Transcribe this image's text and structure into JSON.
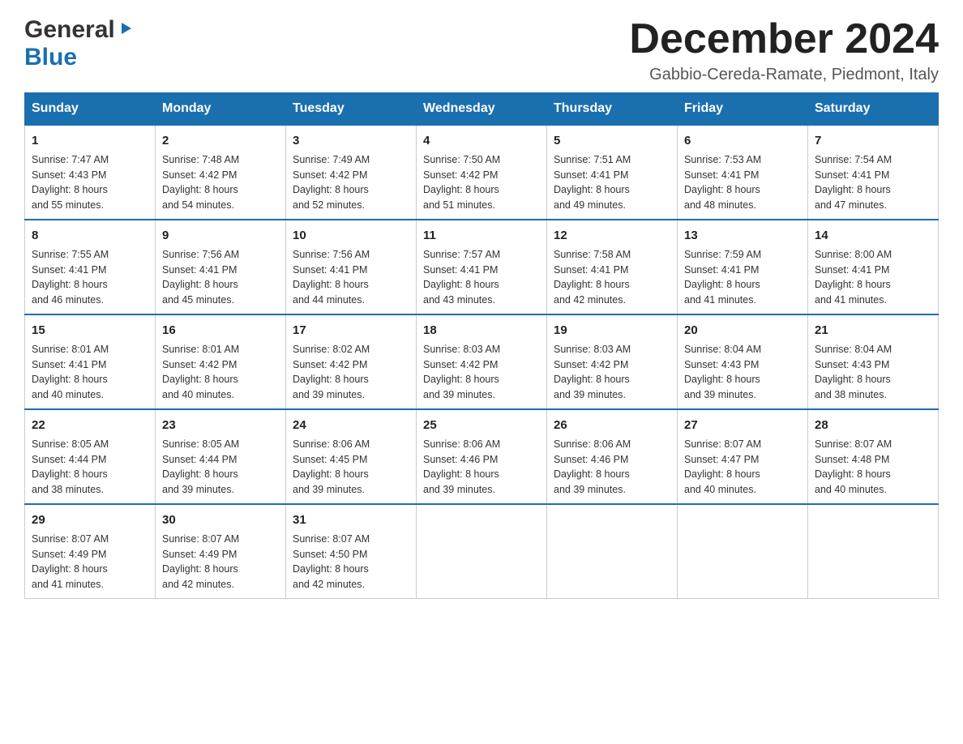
{
  "header": {
    "logo_general": "General",
    "logo_blue": "Blue",
    "month_title": "December 2024",
    "location": "Gabbio-Cereda-Ramate, Piedmont, Italy"
  },
  "days_of_week": [
    "Sunday",
    "Monday",
    "Tuesday",
    "Wednesday",
    "Thursday",
    "Friday",
    "Saturday"
  ],
  "weeks": [
    [
      {
        "day": "1",
        "sunrise": "7:47 AM",
        "sunset": "4:43 PM",
        "daylight": "8 hours and 55 minutes."
      },
      {
        "day": "2",
        "sunrise": "7:48 AM",
        "sunset": "4:42 PM",
        "daylight": "8 hours and 54 minutes."
      },
      {
        "day": "3",
        "sunrise": "7:49 AM",
        "sunset": "4:42 PM",
        "daylight": "8 hours and 52 minutes."
      },
      {
        "day": "4",
        "sunrise": "7:50 AM",
        "sunset": "4:42 PM",
        "daylight": "8 hours and 51 minutes."
      },
      {
        "day": "5",
        "sunrise": "7:51 AM",
        "sunset": "4:41 PM",
        "daylight": "8 hours and 49 minutes."
      },
      {
        "day": "6",
        "sunrise": "7:53 AM",
        "sunset": "4:41 PM",
        "daylight": "8 hours and 48 minutes."
      },
      {
        "day": "7",
        "sunrise": "7:54 AM",
        "sunset": "4:41 PM",
        "daylight": "8 hours and 47 minutes."
      }
    ],
    [
      {
        "day": "8",
        "sunrise": "7:55 AM",
        "sunset": "4:41 PM",
        "daylight": "8 hours and 46 minutes."
      },
      {
        "day": "9",
        "sunrise": "7:56 AM",
        "sunset": "4:41 PM",
        "daylight": "8 hours and 45 minutes."
      },
      {
        "day": "10",
        "sunrise": "7:56 AM",
        "sunset": "4:41 PM",
        "daylight": "8 hours and 44 minutes."
      },
      {
        "day": "11",
        "sunrise": "7:57 AM",
        "sunset": "4:41 PM",
        "daylight": "8 hours and 43 minutes."
      },
      {
        "day": "12",
        "sunrise": "7:58 AM",
        "sunset": "4:41 PM",
        "daylight": "8 hours and 42 minutes."
      },
      {
        "day": "13",
        "sunrise": "7:59 AM",
        "sunset": "4:41 PM",
        "daylight": "8 hours and 41 minutes."
      },
      {
        "day": "14",
        "sunrise": "8:00 AM",
        "sunset": "4:41 PM",
        "daylight": "8 hours and 41 minutes."
      }
    ],
    [
      {
        "day": "15",
        "sunrise": "8:01 AM",
        "sunset": "4:41 PM",
        "daylight": "8 hours and 40 minutes."
      },
      {
        "day": "16",
        "sunrise": "8:01 AM",
        "sunset": "4:42 PM",
        "daylight": "8 hours and 40 minutes."
      },
      {
        "day": "17",
        "sunrise": "8:02 AM",
        "sunset": "4:42 PM",
        "daylight": "8 hours and 39 minutes."
      },
      {
        "day": "18",
        "sunrise": "8:03 AM",
        "sunset": "4:42 PM",
        "daylight": "8 hours and 39 minutes."
      },
      {
        "day": "19",
        "sunrise": "8:03 AM",
        "sunset": "4:42 PM",
        "daylight": "8 hours and 39 minutes."
      },
      {
        "day": "20",
        "sunrise": "8:04 AM",
        "sunset": "4:43 PM",
        "daylight": "8 hours and 39 minutes."
      },
      {
        "day": "21",
        "sunrise": "8:04 AM",
        "sunset": "4:43 PM",
        "daylight": "8 hours and 38 minutes."
      }
    ],
    [
      {
        "day": "22",
        "sunrise": "8:05 AM",
        "sunset": "4:44 PM",
        "daylight": "8 hours and 38 minutes."
      },
      {
        "day": "23",
        "sunrise": "8:05 AM",
        "sunset": "4:44 PM",
        "daylight": "8 hours and 39 minutes."
      },
      {
        "day": "24",
        "sunrise": "8:06 AM",
        "sunset": "4:45 PM",
        "daylight": "8 hours and 39 minutes."
      },
      {
        "day": "25",
        "sunrise": "8:06 AM",
        "sunset": "4:46 PM",
        "daylight": "8 hours and 39 minutes."
      },
      {
        "day": "26",
        "sunrise": "8:06 AM",
        "sunset": "4:46 PM",
        "daylight": "8 hours and 39 minutes."
      },
      {
        "day": "27",
        "sunrise": "8:07 AM",
        "sunset": "4:47 PM",
        "daylight": "8 hours and 40 minutes."
      },
      {
        "day": "28",
        "sunrise": "8:07 AM",
        "sunset": "4:48 PM",
        "daylight": "8 hours and 40 minutes."
      }
    ],
    [
      {
        "day": "29",
        "sunrise": "8:07 AM",
        "sunset": "4:49 PM",
        "daylight": "8 hours and 41 minutes."
      },
      {
        "day": "30",
        "sunrise": "8:07 AM",
        "sunset": "4:49 PM",
        "daylight": "8 hours and 42 minutes."
      },
      {
        "day": "31",
        "sunrise": "8:07 AM",
        "sunset": "4:50 PM",
        "daylight": "8 hours and 42 minutes."
      },
      null,
      null,
      null,
      null
    ]
  ],
  "labels": {
    "sunrise": "Sunrise:",
    "sunset": "Sunset:",
    "daylight": "Daylight:"
  },
  "colors": {
    "header_bg": "#1a6faf",
    "border_top": "#1a6faf"
  }
}
